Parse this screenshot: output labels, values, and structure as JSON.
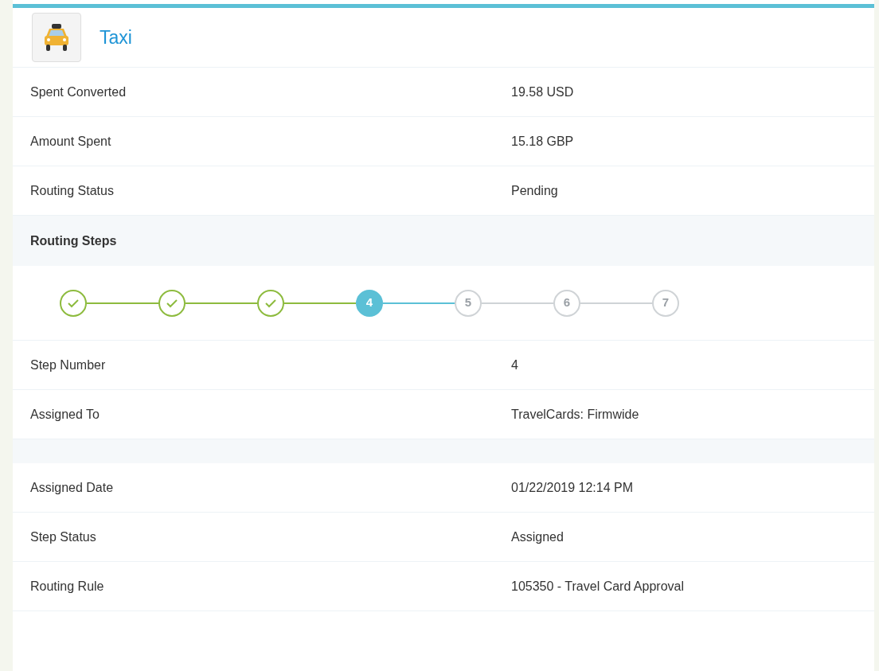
{
  "header": {
    "title": "Taxi"
  },
  "details": [
    {
      "label": "Spent Converted",
      "value": "19.58 USD"
    },
    {
      "label": "Amount Spent",
      "value": "15.18 GBP"
    },
    {
      "label": "Routing Status",
      "value": "Pending"
    }
  ],
  "routing_steps": {
    "title": "Routing Steps",
    "steps": [
      {
        "completed": true,
        "current": false
      },
      {
        "completed": true,
        "current": false
      },
      {
        "completed": true,
        "current": false
      },
      {
        "label": "4",
        "completed": false,
        "current": true
      },
      {
        "label": "5",
        "completed": false,
        "current": false
      },
      {
        "label": "6",
        "completed": false,
        "current": false
      },
      {
        "label": "7",
        "completed": false,
        "current": false
      }
    ]
  },
  "step_details": [
    {
      "kind": "row",
      "label": "Step Number",
      "value": "4"
    },
    {
      "kind": "row",
      "label": "Assigned To",
      "value": "TravelCards: Firmwide"
    },
    {
      "kind": "spacer"
    },
    {
      "kind": "row",
      "label": "Assigned Date",
      "value": "01/22/2019 12:14 PM"
    },
    {
      "kind": "row",
      "label": "Step Status",
      "value": "Assigned"
    },
    {
      "kind": "row",
      "label": "Routing Rule",
      "value": "105350 - Travel Card Approval"
    }
  ]
}
